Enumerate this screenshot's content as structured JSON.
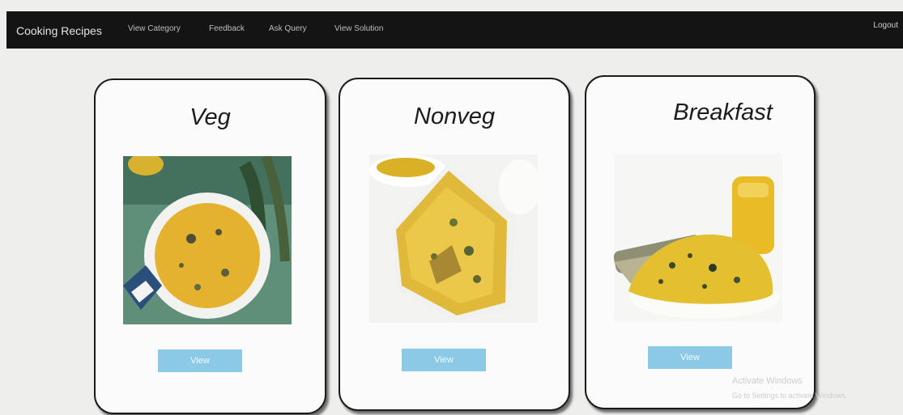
{
  "navbar": {
    "brand": "Cooking Recipes",
    "links": [
      "View Category",
      "Feedback",
      "Ask Query",
      "View Solution"
    ],
    "logout": "Logout"
  },
  "cards": [
    {
      "title": "Veg",
      "button": "View",
      "image": "veg-dish-image"
    },
    {
      "title": "Nonveg",
      "button": "View",
      "image": "nonveg-dish-image"
    },
    {
      "title": "Breakfast",
      "button": "View",
      "image": "breakfast-dish-image"
    }
  ],
  "watermark": {
    "title": "Activate Windows",
    "subtitle": "Go to Settings to activate Windows."
  },
  "colors": {
    "navbar_bg": "#141414",
    "button_bg": "#8cc9e6",
    "food_yellow": "#e0b92f",
    "page_bg": "#eeeeec"
  }
}
